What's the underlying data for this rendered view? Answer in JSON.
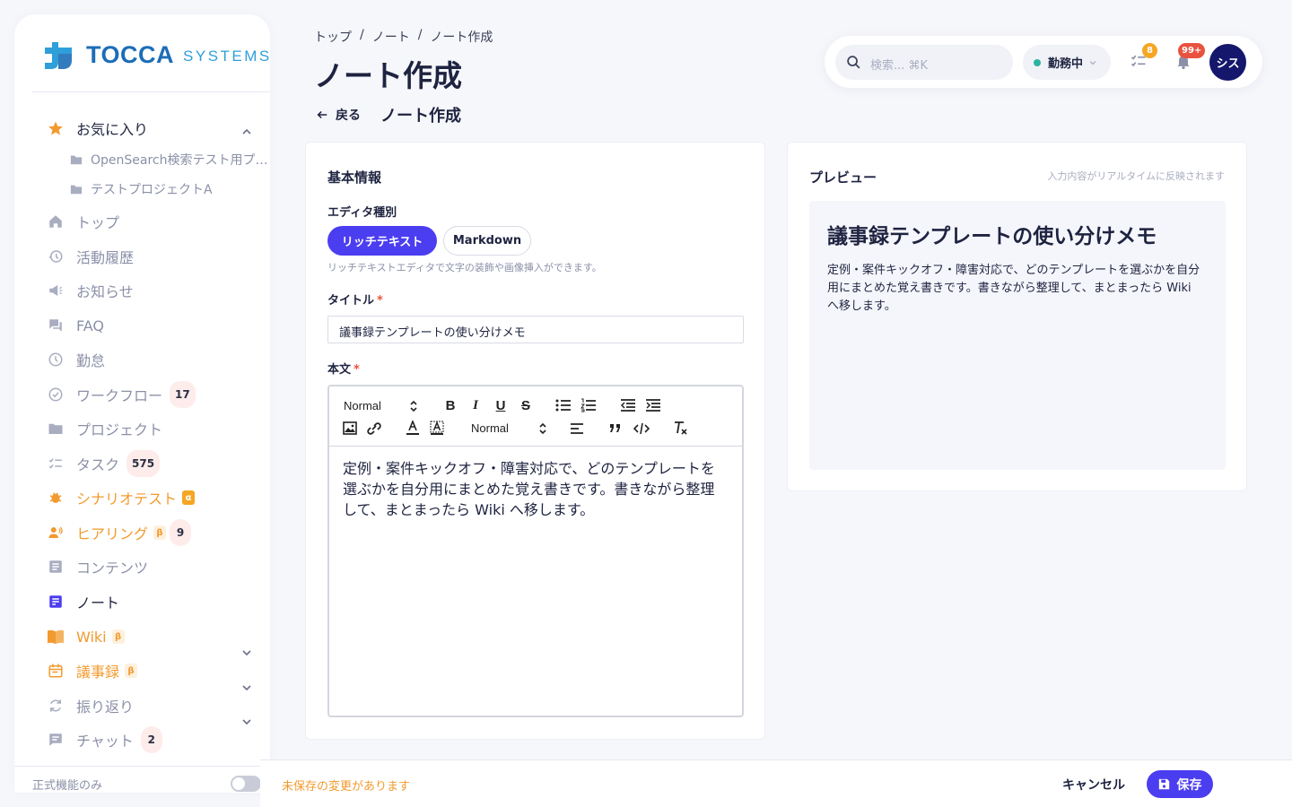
{
  "brand": {
    "name": "TOCCA",
    "sub": "SYSTEMS"
  },
  "sidebar": {
    "favorites_label": "お気に入り",
    "favorites": [
      "OpenSearch検索テスト用プ…",
      "テストプロジェクトA"
    ],
    "items": [
      {
        "label": "トップ",
        "icon": "home-icon"
      },
      {
        "label": "活動履歴",
        "icon": "history-icon"
      },
      {
        "label": "お知らせ",
        "icon": "megaphone-icon"
      },
      {
        "label": "FAQ",
        "icon": "faq-icon"
      },
      {
        "label": "勤怠",
        "icon": "clock-icon"
      },
      {
        "label": "ワークフロー",
        "icon": "check-circle-icon",
        "count": "17"
      },
      {
        "label": "プロジェクト",
        "icon": "folder-icon"
      },
      {
        "label": "タスク",
        "icon": "tasks-icon",
        "count": "575"
      },
      {
        "label": "シナリオテスト",
        "icon": "bug-icon",
        "badge": "α"
      },
      {
        "label": "ヒアリング",
        "icon": "people-icon",
        "badge": "β",
        "count": "9"
      },
      {
        "label": "コンテンツ",
        "icon": "document-icon"
      },
      {
        "label": "ノート",
        "icon": "note-icon"
      },
      {
        "label": "Wiki",
        "icon": "book-icon",
        "badge": "β"
      },
      {
        "label": "議事録",
        "icon": "calendar-icon",
        "badge": "β"
      },
      {
        "label": "振り返り",
        "icon": "refresh-icon"
      },
      {
        "label": "チャット",
        "icon": "chat-icon",
        "count": "2"
      }
    ],
    "footer_label": "正式機能のみ"
  },
  "header": {
    "breadcrumb": [
      "トップ",
      "/",
      "ノート",
      "/",
      "ノート作成"
    ],
    "title": "ノート作成",
    "search_placeholder": "検索... ⌘K",
    "status": "勤務中",
    "task_badge": "8",
    "notification_badge": "99+",
    "avatar": "シス"
  },
  "back": {
    "label": "戻る",
    "title": "ノート作成"
  },
  "form": {
    "section": "基本情報",
    "editor_type_label": "エディタ種別",
    "editor_types": [
      "リッチテキスト",
      "Markdown"
    ],
    "editor_hint": "リッチテキストエディタで文字の装飾や画像挿入ができます。",
    "title_label": "タイトル",
    "required_mark": "*",
    "title_value": "議事録テンプレートの使い分けメモ",
    "body_label": "本文",
    "toolbar": {
      "header_select": "Normal",
      "size_select": "Normal"
    },
    "body_text": "定例・案件キックオフ・障害対応で、どのテンプレートを選ぶかを自分用にまとめた覚え書きです。書きながら整理して、まとまったら Wiki へ移します。"
  },
  "preview": {
    "label": "プレビュー",
    "note": "入力内容がリアルタイムに反映されます",
    "title": "議事録テンプレートの使い分けメモ",
    "body": "定例・案件キックオフ・障害対応で、どのテンプレートを選ぶかを自分用にまとめた覚え書きです。書きながら整理して、まとまったら Wiki へ移します。"
  },
  "footer": {
    "unsaved": "未保存の変更があります",
    "cancel": "キャンセル",
    "save": "保存"
  },
  "colors": {
    "primary": "#4b3df0",
    "accent_orange": "#f29a2e",
    "brand_blue": "#1c6db7",
    "avatar": "#14176b"
  }
}
